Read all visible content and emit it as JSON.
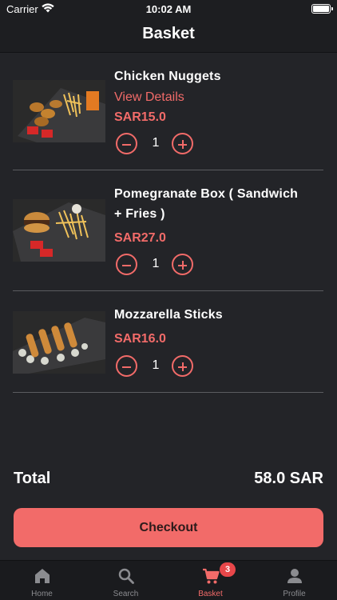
{
  "status_bar": {
    "carrier": "Carrier",
    "time": "10:02 AM"
  },
  "header": {
    "title": "Basket"
  },
  "items": [
    {
      "name": "Chicken Nuggets",
      "details_label": "View Details",
      "price": "SAR15.0",
      "quantity": "1"
    },
    {
      "name": "Pomegranate Box ( Sandwich + Fries )",
      "price": "SAR27.0",
      "quantity": "1"
    },
    {
      "name": "Mozzarella Sticks",
      "price": "SAR16.0",
      "quantity": "1"
    }
  ],
  "summary": {
    "total_label": "Total",
    "total_value": "58.0 SAR"
  },
  "checkout": {
    "label": "Checkout"
  },
  "tabs": [
    {
      "label": "Home",
      "icon": "home-icon"
    },
    {
      "label": "Search",
      "icon": "search-icon"
    },
    {
      "label": "Basket",
      "icon": "cart-icon",
      "badge": "3",
      "active": true
    },
    {
      "label": "Profile",
      "icon": "profile-icon"
    }
  ],
  "colors": {
    "accent": "#f26b69",
    "background": "#232428",
    "badge": "#e8474a"
  }
}
